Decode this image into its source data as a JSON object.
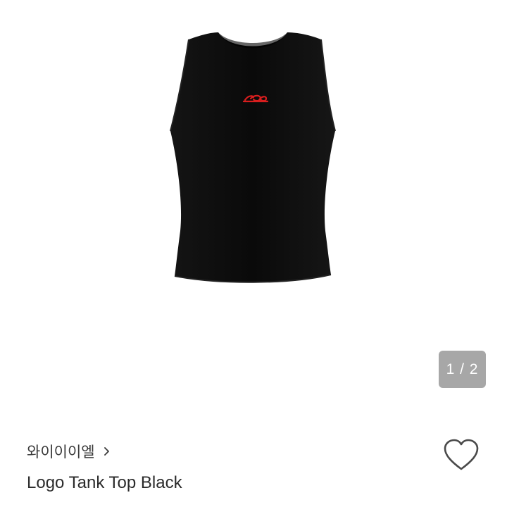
{
  "gallery": {
    "image_alt": "Logo Tank Top Black product photo",
    "counter": "1 / 2",
    "garment_color": "#0b0b0b",
    "logo_color": "#d81e1e"
  },
  "product": {
    "brand": "와이이이엘",
    "brand_chevron_icon": "chevron-right-icon",
    "title": "Logo Tank Top Black",
    "wishlist_icon": "heart-outline-icon"
  }
}
